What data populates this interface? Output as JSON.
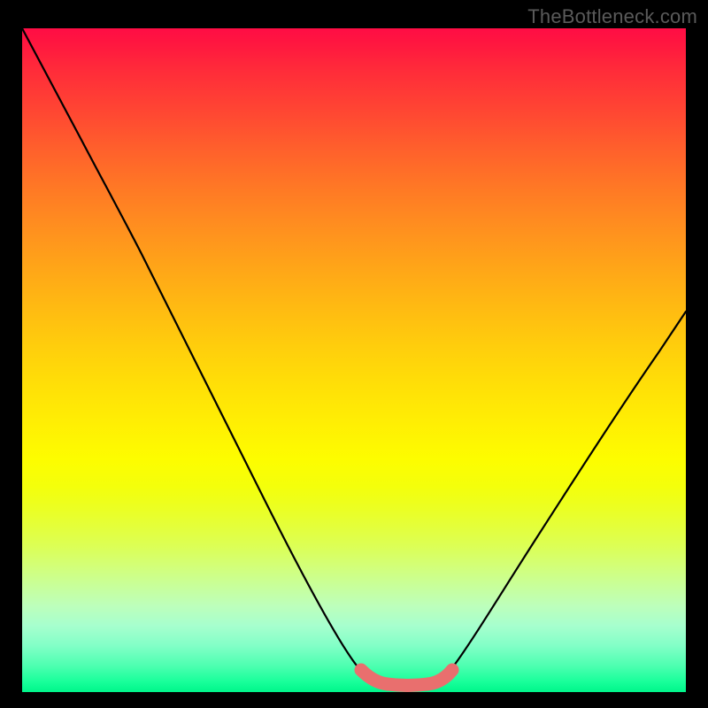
{
  "watermark": "TheBottleneck.com",
  "chart_data": {
    "type": "line",
    "title": "",
    "xlabel": "",
    "ylabel": "",
    "series": [
      {
        "name": "bottleneck-curve",
        "points": [
          {
            "x": 0.0,
            "y": 1.0
          },
          {
            "x": 0.09,
            "y": 0.83
          },
          {
            "x": 0.15,
            "y": 0.72
          },
          {
            "x": 0.21,
            "y": 0.6
          },
          {
            "x": 0.27,
            "y": 0.48
          },
          {
            "x": 0.33,
            "y": 0.36
          },
          {
            "x": 0.39,
            "y": 0.24
          },
          {
            "x": 0.45,
            "y": 0.12
          },
          {
            "x": 0.5,
            "y": 0.04
          },
          {
            "x": 0.53,
            "y": 0.015
          },
          {
            "x": 0.58,
            "y": 0.01
          },
          {
            "x": 0.62,
            "y": 0.015
          },
          {
            "x": 0.65,
            "y": 0.04
          },
          {
            "x": 0.7,
            "y": 0.12
          },
          {
            "x": 0.78,
            "y": 0.24
          },
          {
            "x": 0.86,
            "y": 0.36
          },
          {
            "x": 0.93,
            "y": 0.46
          },
          {
            "x": 1.0,
            "y": 0.56
          }
        ],
        "color": "#000000"
      },
      {
        "name": "optimal-band",
        "points": [
          {
            "x": 0.51,
            "y": 0.023
          },
          {
            "x": 0.53,
            "y": 0.013
          },
          {
            "x": 0.56,
            "y": 0.01
          },
          {
            "x": 0.59,
            "y": 0.01
          },
          {
            "x": 0.62,
            "y": 0.013
          },
          {
            "x": 0.64,
            "y": 0.023
          }
        ],
        "color": "#e96f6e"
      }
    ],
    "xlim": [
      0,
      1
    ],
    "ylim": [
      0,
      1
    ],
    "grid": false
  },
  "colors": {
    "frame": "#000000",
    "curve": "#000000",
    "band": "#e96f6e"
  }
}
